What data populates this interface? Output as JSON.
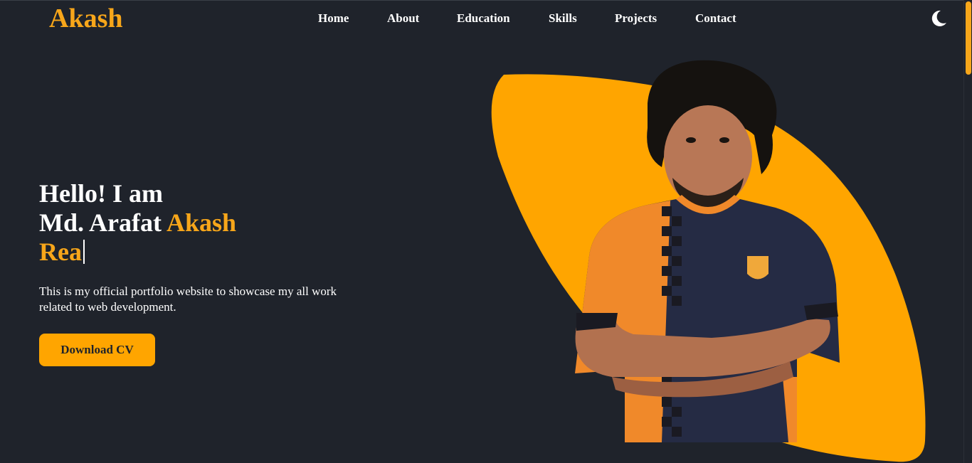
{
  "header": {
    "logo": "Akash",
    "nav": [
      {
        "label": "Home"
      },
      {
        "label": "About"
      },
      {
        "label": "Education"
      },
      {
        "label": "Skills"
      },
      {
        "label": "Projects"
      },
      {
        "label": "Contact"
      }
    ],
    "theme_icon": "moon-icon"
  },
  "hero": {
    "greeting": "Hello! I am",
    "name_first": "Md. Arafat ",
    "name_accent": "Akash",
    "typed_text": "Rea",
    "description": "This is my official portfolio website to showcase my all work related to web development.",
    "cta_label": "Download CV"
  },
  "colors": {
    "background": "#1f232b",
    "accent": "#f7a61a",
    "button": "#ffa500",
    "text": "#ffffff"
  }
}
